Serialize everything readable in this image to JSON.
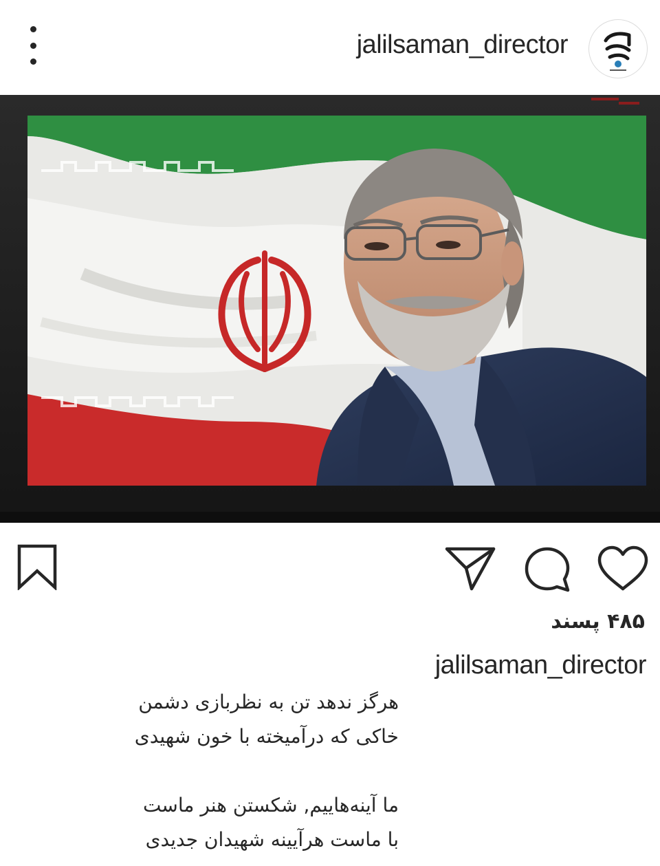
{
  "header": {
    "username": "jalilsaman_director"
  },
  "post": {
    "likes_text": "۴۸۵ پسند",
    "caption_username": "jalilsaman_director",
    "caption_lines": [
      "هرگز ندهد تن به نظربازی دشمن",
      "خاکی که درآمیخته با خون شهیدی",
      "",
      "ما آینه‌هاییم, شکستن هنر ماست",
      "با ماست هرآیینه شهیدان جدیدی"
    ]
  },
  "colors": {
    "text": "#262626",
    "flag_green": "#2e8b3e",
    "flag_red": "#d32a2a",
    "frame_dark": "#1c1c1c"
  },
  "icons": {
    "more": "vertical-dots-icon",
    "save": "bookmark-icon",
    "share": "paper-plane-icon",
    "comment": "speech-bubble-icon",
    "like": "heart-icon"
  }
}
